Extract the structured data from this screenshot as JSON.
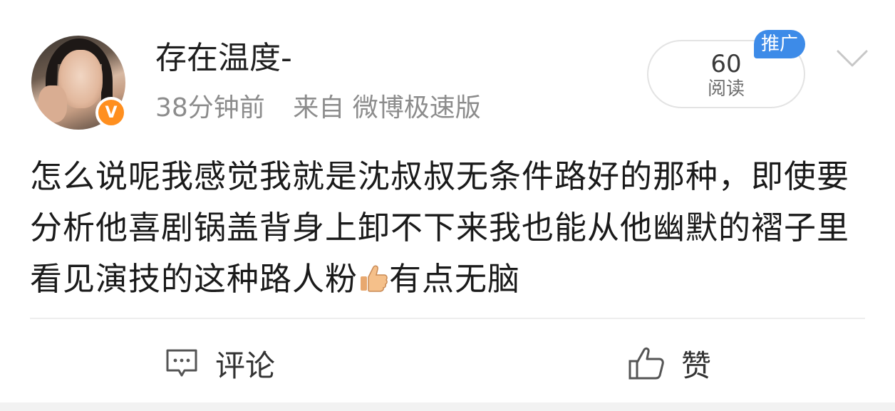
{
  "author": {
    "name": "存在温度-",
    "verified": true,
    "verified_mark": "V"
  },
  "meta": {
    "time": "38分钟前",
    "source": "来自 微博极速版"
  },
  "stats": {
    "read_count": "60",
    "read_label": "阅读",
    "promo_badge": "推广"
  },
  "post": {
    "text_before_emoji": "怎么说呢我感觉我就是沈叔叔无条件路好的那种，即使要分析他喜剧锅盖背身上卸不下来我也能从他幽默的褶子里看见演技的这种路人粉",
    "emoji": "thumbs-up-icon",
    "text_after_emoji": "有点无脑"
  },
  "actions": {
    "comment_label": "评论",
    "like_label": "赞"
  },
  "colors": {
    "verified_orange": "#ff8f1f",
    "promo_blue": "#3d8be8",
    "meta_gray": "#8c8c8c"
  }
}
